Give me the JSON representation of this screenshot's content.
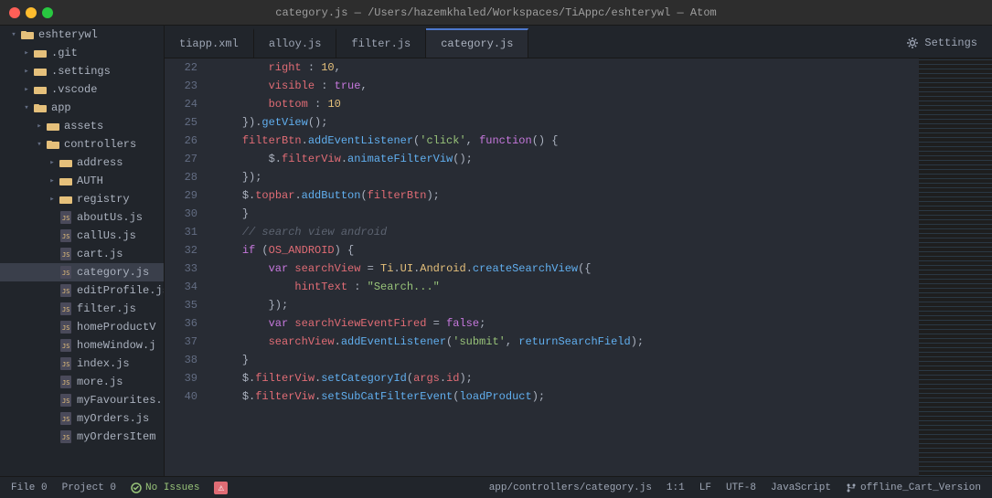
{
  "titlebar": {
    "text": "category.js — /Users/hazemkhaled/Workspaces/TiAppc/eshterywl — Atom"
  },
  "tabs": [
    {
      "id": "tiapp",
      "label": "tiapp.xml",
      "active": false
    },
    {
      "id": "alloy",
      "label": "alloy.js",
      "active": false
    },
    {
      "id": "filter",
      "label": "filter.js",
      "active": false
    },
    {
      "id": "category",
      "label": "category.js",
      "active": true
    }
  ],
  "settings_tab": "Settings",
  "sidebar": {
    "project": "eshterywl",
    "items": [
      {
        "id": "git",
        "label": ".git",
        "type": "folder",
        "depth": 2,
        "collapsed": true
      },
      {
        "id": "settings",
        "label": ".settings",
        "type": "folder",
        "depth": 2,
        "collapsed": true
      },
      {
        "id": "vscode",
        "label": ".vscode",
        "type": "folder",
        "depth": 2,
        "collapsed": true
      },
      {
        "id": "app",
        "label": "app",
        "type": "folder",
        "depth": 2,
        "expanded": true
      },
      {
        "id": "assets",
        "label": "assets",
        "type": "folder",
        "depth": 3,
        "collapsed": true
      },
      {
        "id": "controllers",
        "label": "controllers",
        "type": "folder",
        "depth": 3,
        "expanded": true
      },
      {
        "id": "address",
        "label": "address",
        "type": "folder",
        "depth": 4,
        "collapsed": true
      },
      {
        "id": "auth",
        "label": "AUTH",
        "type": "folder",
        "depth": 4,
        "collapsed": true
      },
      {
        "id": "registry",
        "label": "registry",
        "type": "folder",
        "depth": 4,
        "collapsed": true
      },
      {
        "id": "aboutUs",
        "label": "aboutUs.js",
        "type": "file",
        "depth": 4
      },
      {
        "id": "callUs",
        "label": "callUs.js",
        "type": "file",
        "depth": 4
      },
      {
        "id": "cart",
        "label": "cart.js",
        "type": "file",
        "depth": 4
      },
      {
        "id": "category",
        "label": "category.js",
        "type": "file",
        "depth": 4,
        "active": true
      },
      {
        "id": "editProfile",
        "label": "editProfile.js",
        "type": "file",
        "depth": 4
      },
      {
        "id": "filter",
        "label": "filter.js",
        "type": "file",
        "depth": 4
      },
      {
        "id": "homeProductV",
        "label": "homeProductV",
        "type": "file",
        "depth": 4
      },
      {
        "id": "homeWindow",
        "label": "homeWindow.j",
        "type": "file",
        "depth": 4
      },
      {
        "id": "index",
        "label": "index.js",
        "type": "file",
        "depth": 4
      },
      {
        "id": "more",
        "label": "more.js",
        "type": "file",
        "depth": 4
      },
      {
        "id": "myFavourites",
        "label": "myFavourites.",
        "type": "file",
        "depth": 4
      },
      {
        "id": "myOrders",
        "label": "myOrders.js",
        "type": "file",
        "depth": 4
      },
      {
        "id": "myOrdersItem",
        "label": "myOrdersItem",
        "type": "file",
        "depth": 4
      }
    ]
  },
  "code": {
    "lines": [
      {
        "num": "22",
        "content": "    right : 10,"
      },
      {
        "num": "23",
        "content": "    visible : true,"
      },
      {
        "num": "24",
        "content": "    bottom : 10"
      },
      {
        "num": "25",
        "content": "}).getView();"
      },
      {
        "num": "26",
        "content": "filterBtn.addEventListener('click', function() {"
      },
      {
        "num": "27",
        "content": "    $.filterViw.animateFilterViw();"
      },
      {
        "num": "28",
        "content": "});"
      },
      {
        "num": "29",
        "content": "$.topbar.addButton(filterBtn);"
      },
      {
        "num": "30",
        "content": "}"
      },
      {
        "num": "31",
        "content": "// search view android"
      },
      {
        "num": "32",
        "content": "if (OS_ANDROID) {"
      },
      {
        "num": "33",
        "content": "    var searchView = Ti.UI.Android.createSearchView({"
      },
      {
        "num": "34",
        "content": "        hintText : \"Search...\""
      },
      {
        "num": "35",
        "content": "    });"
      },
      {
        "num": "36",
        "content": "    var searchViewEventFired = false;"
      },
      {
        "num": "37",
        "content": "    searchView.addEventListener('submit', returnSearchField);"
      },
      {
        "num": "38",
        "content": "}"
      },
      {
        "num": "39",
        "content": "$.filterViw.setCategoryId(args.id);"
      },
      {
        "num": "40",
        "content": "$.filterViw.setSubCatFilterEvent(loadProduct);"
      }
    ]
  },
  "status_bar": {
    "file": "File 0",
    "project": "Project 0",
    "no_issues": "No Issues",
    "path": "app/controllers/category.js",
    "position": "1:1",
    "line_ending": "LF",
    "encoding": "UTF-8",
    "language": "JavaScript",
    "git_branch": "offline_Cart_Version"
  }
}
